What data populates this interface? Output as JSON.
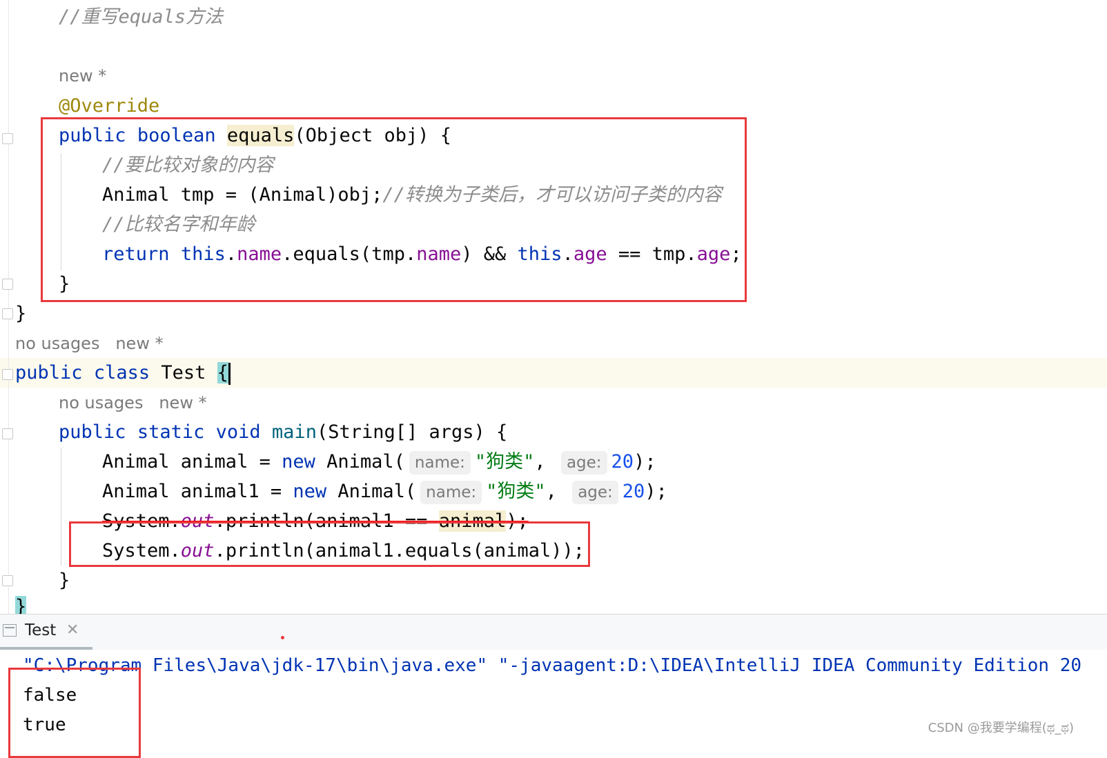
{
  "editor": {
    "comment_override": "//重写equals方法",
    "hint_new": "new *",
    "annotation": "@Override",
    "equals_sig": {
      "kw_public": "public",
      "kw_boolean": "boolean",
      "method": "equals",
      "rest": "(Object obj) {"
    },
    "comment_compare_content": "//要比较对象的内容",
    "cast_line": {
      "code": "Animal tmp = (Animal)obj;",
      "comment": "//转换为子类后，才可以访问子类的内容"
    },
    "comment_name_age": "//比较名字和年龄",
    "return_line": {
      "kw_return": "return",
      "kw_this1": "this",
      "dot1": ".",
      "field_name1": "name",
      "mid1": ".equals(tmp.",
      "field_name2": "name",
      "mid2": ") && ",
      "kw_this2": "this",
      "dot2": ".",
      "field_age1": "age",
      "mid3": " == tmp.",
      "field_age2": "age",
      "end": ";"
    },
    "close_brace": "}",
    "close_brace_class": "}",
    "test_hint_usages": "no usages",
    "test_hint_new": "new *",
    "test_class": {
      "kw_public": "public",
      "kw_class": "class",
      "name": "Test",
      "brace": "{"
    },
    "main_hint_usages": "no usages",
    "main_hint_new": "new *",
    "main_sig": {
      "kw_public": "public",
      "kw_static": "static",
      "kw_void": "void",
      "method": "main",
      "rest": "(String[] args) {"
    },
    "animal_line": {
      "lhs": "Animal animal = ",
      "kw_new": "new",
      "ctor": " Animal(",
      "param_name": "name:",
      "str": "\"狗类\"",
      "comma": ",",
      "param_age": "age:",
      "num": "20",
      "end": ");"
    },
    "animal1_line": {
      "lhs": "Animal animal1 = ",
      "kw_new": "new",
      "ctor": " Animal(",
      "param_name": "name:",
      "str": "\"狗类\"",
      "comma": ",",
      "param_age": "age:",
      "num": "20",
      "end": ");"
    },
    "println1": {
      "a": "System.",
      "out": "out",
      "b": ".println(animal1 == ",
      "c": "animal",
      "d": ");"
    },
    "println2": {
      "a": "System.",
      "out": "out",
      "b": ".println(animal1.equals(animal));"
    },
    "main_close": "}",
    "class_close": "}"
  },
  "run_panel": {
    "tab_label": "Test",
    "close_glyph": "✕",
    "console_lines": [
      "\"C:\\Program Files\\Java\\jdk-17\\bin\\java.exe\" \"-javaagent:D:\\IDEA\\IntelliJ IDEA Community Edition 20",
      "false",
      "true"
    ]
  },
  "watermark": "CSDN @我要学编程(ಥ_ಥ)"
}
